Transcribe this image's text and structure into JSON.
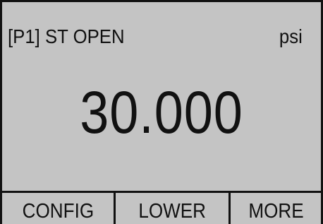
{
  "display": {
    "status_text": "[P1] ST OPEN",
    "unit": "psi",
    "reading": "30.000"
  },
  "softkeys": [
    {
      "label": "CONFIG"
    },
    {
      "label": "LOWER"
    },
    {
      "label": "MORE"
    }
  ],
  "colors": {
    "screen_background": "#c4c4c4",
    "foreground": "#111111"
  }
}
